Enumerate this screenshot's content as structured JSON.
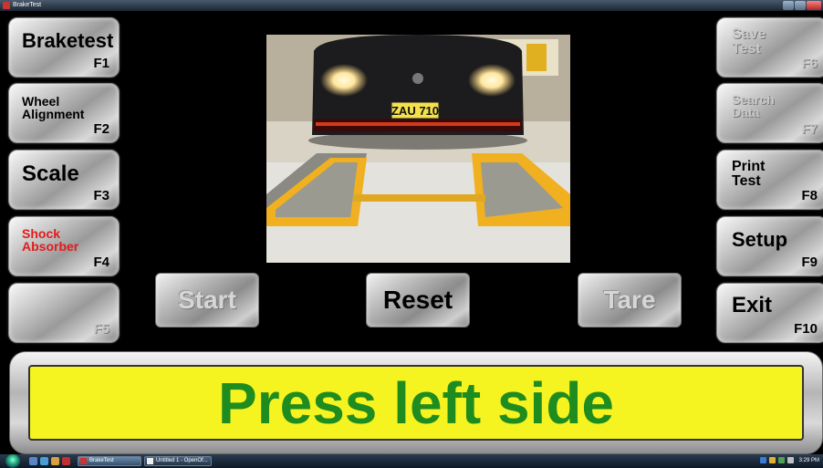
{
  "window": {
    "title": "BrakeTest"
  },
  "left_buttons": [
    {
      "label_lines": [
        "Braketest"
      ],
      "key": "F1",
      "enabled": true,
      "label_color": "#000000"
    },
    {
      "label_lines": [
        "Wheel",
        "Alignment"
      ],
      "key": "F2",
      "enabled": true,
      "label_color": "#000000"
    },
    {
      "label_lines": [
        "Scale"
      ],
      "key": "F3",
      "enabled": true,
      "label_color": "#000000"
    },
    {
      "label_lines": [
        "Shock",
        "Absorber"
      ],
      "key": "F4",
      "enabled": true,
      "label_color": "#e31b1b"
    },
    {
      "label_lines": [
        ""
      ],
      "key": "F5",
      "enabled": false
    }
  ],
  "right_buttons": [
    {
      "label_lines": [
        "Save",
        "Test"
      ],
      "key": "F6",
      "enabled": false
    },
    {
      "label_lines": [
        "Search",
        "Data"
      ],
      "key": "F7",
      "enabled": false
    },
    {
      "label_lines": [
        "Print",
        "Test"
      ],
      "key": "F8",
      "enabled": true
    },
    {
      "label_lines": [
        "Setup"
      ],
      "key": "F9",
      "enabled": true
    },
    {
      "label_lines": [
        "Exit"
      ],
      "key": "F10",
      "enabled": true
    }
  ],
  "center_buttons": {
    "start": {
      "label": "Start",
      "enabled": false
    },
    "reset": {
      "label": "Reset",
      "enabled": true
    },
    "tare": {
      "label": "Tare",
      "enabled": false
    }
  },
  "camera": {
    "plate": "ZAU 710"
  },
  "status": {
    "message": "Press left side",
    "background": "#f6f420",
    "text_color": "#1f8c1f"
  },
  "taskbar": {
    "tasks": [
      {
        "label": "BrakeTest",
        "active": true
      },
      {
        "label": "Untitled 1 - OpenOf...",
        "active": false
      }
    ],
    "clock": "3:29 PM"
  }
}
